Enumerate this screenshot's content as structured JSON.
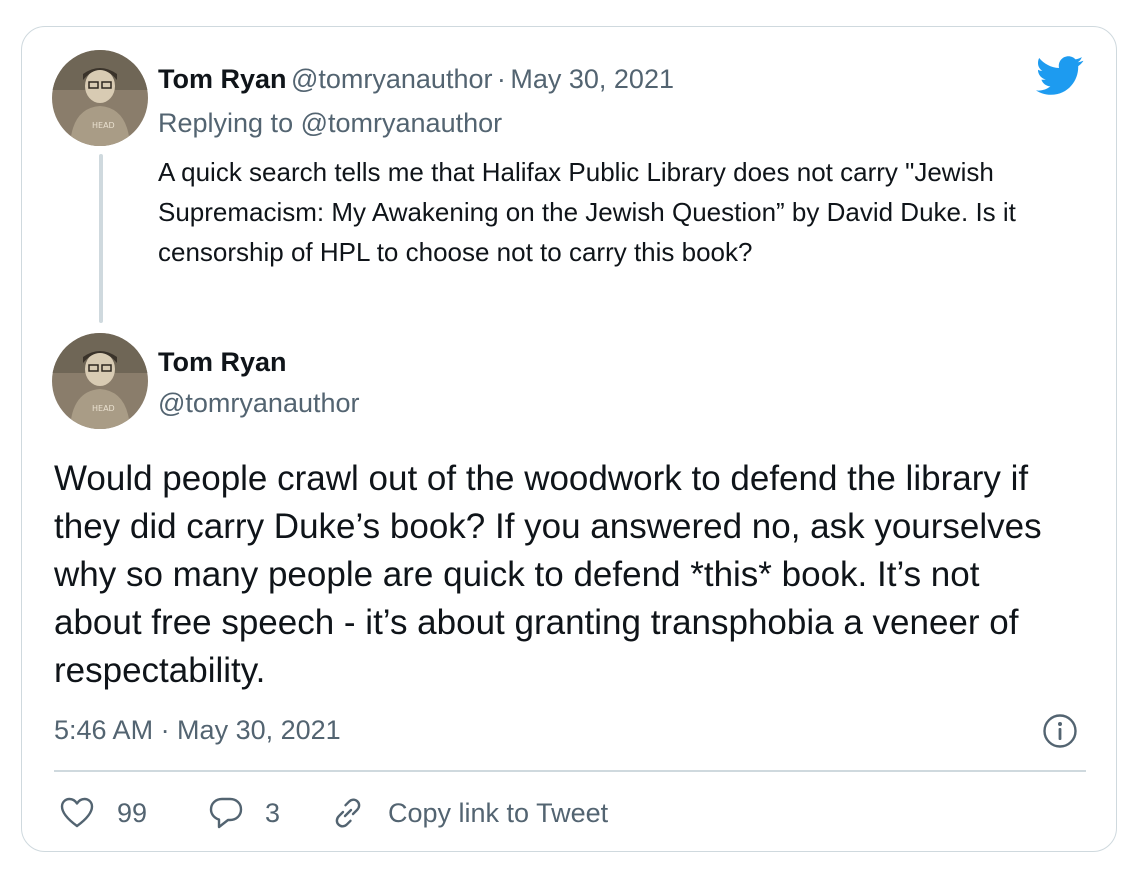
{
  "quoted_tweet": {
    "display_name": "Tom Ryan",
    "handle": "@tomryanauthor",
    "separator": "·",
    "date": "May 30, 2021",
    "replying_prefix": "Replying to",
    "replying_handle": "@tomryanauthor",
    "text": "A quick search tells me that Halifax Public Library does not carry \"Jewish Supremacism: My Awakening on the Jewish Question” by David Duke. Is it censorship of HPL to choose not to carry this book?"
  },
  "main_tweet": {
    "display_name": "Tom Ryan",
    "handle": "@tomryanauthor",
    "text": "Would people crawl out of the woodwork to defend the library if they did carry Duke’s book? If you answered no, ask yourselves why so many people are quick to defend *this* book. It’s not about free speech - it’s about granting transphobia a veneer of respectability.",
    "timestamp": "5:46 AM · May 30, 2021"
  },
  "actions": {
    "likes": "99",
    "replies": "3",
    "copy_link_label": "Copy link to Tweet"
  },
  "icons": {
    "brand": "twitter-bird-icon",
    "like": "heart-icon",
    "reply": "speech-bubble-icon",
    "copy": "link-icon",
    "info": "info-icon"
  },
  "colors": {
    "brand_blue": "#1d9bf0",
    "text": "#0f1419",
    "muted": "#536471",
    "border": "#cfd9de"
  }
}
